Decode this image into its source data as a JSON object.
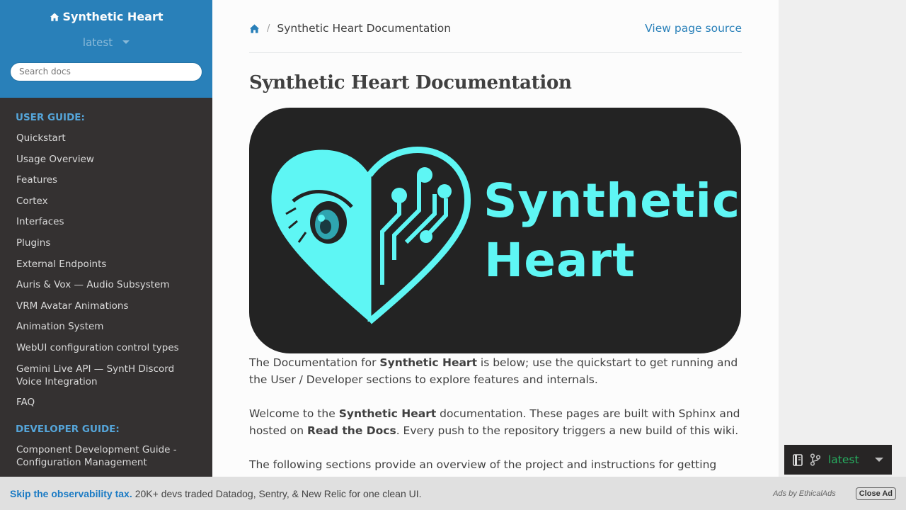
{
  "sidebar": {
    "project_title": "Synthetic Heart",
    "version": "latest",
    "search_placeholder": "Search docs",
    "sections": [
      {
        "caption": "USER GUIDE:",
        "items": [
          "Quickstart",
          "Usage Overview",
          "Features",
          "Cortex",
          "Interfaces",
          "Plugins",
          "External Endpoints",
          "Auris & Vox — Audio Subsystem",
          "VRM Avatar Animations",
          "Animation System",
          "WebUI configuration control types",
          "Gemini Live API — SyntH Discord Voice Integration",
          "FAQ"
        ]
      },
      {
        "caption": "DEVELOPER GUIDE:",
        "items": [
          "Component Development Guide - Configuration Management"
        ]
      }
    ]
  },
  "breadcrumb": {
    "current": "Synthetic Heart Documentation",
    "source_link": "View page source"
  },
  "page": {
    "title": "Synthetic Heart Documentation",
    "logo": {
      "line1": "Synthetic",
      "line2": "Heart",
      "color": "#5ef6f4",
      "background": "#232323"
    },
    "p1": {
      "a": "The Documentation for ",
      "b": "Synthetic Heart",
      "c": " is below; use the quickstart to get running and the User / Developer sections to explore features and internals."
    },
    "p2": {
      "a": "Welcome to the ",
      "b": "Synthetic Heart",
      "c": " documentation. These pages are built with Sphinx and hosted on ",
      "d": "Read the Docs",
      "e": ". Every push to the repository triggers a new build of this wiki."
    },
    "p3": "The following sections provide an overview of the project and instructions for getting started."
  },
  "flyout": {
    "version": "latest"
  },
  "ad": {
    "headline": "Skip the observability tax.",
    "text": "20K+ devs traded Datadog, Sentry, & New Relic for one clean UI.",
    "by": "Ads by EthicalAds",
    "close_label": "Close Ad"
  },
  "colors": {
    "sidebar_header": "#2980b9",
    "sidebar_bg": "#343131",
    "caption": "#55a5d9",
    "link": "#2980b9",
    "flyout_version": "#27ae60"
  },
  "icons": {
    "home": "home-icon",
    "caret": "caret-down-icon",
    "book": "book-icon",
    "branch": "git-branch-icon"
  }
}
